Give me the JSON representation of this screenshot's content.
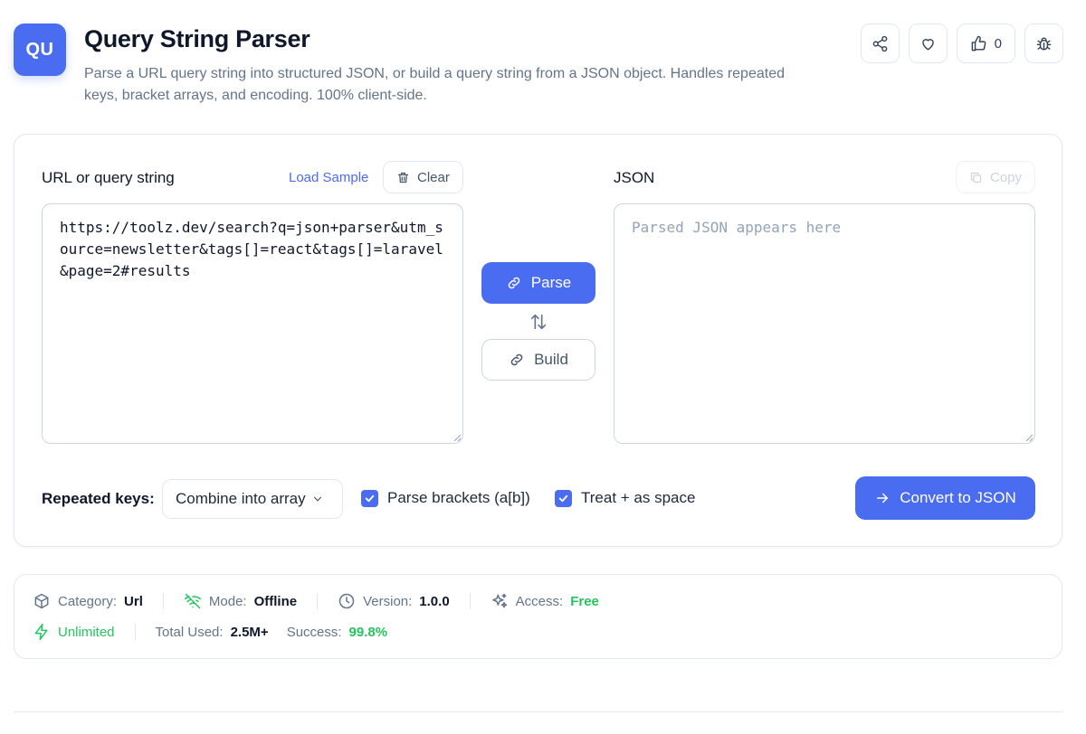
{
  "header": {
    "logo_text": "QU",
    "title": "Query String Parser",
    "description": "Parse a URL query string into structured JSON, or build a query string from a JSON object. Handles repeated keys, bracket arrays, and encoding. 100% client-side.",
    "like_count": "0"
  },
  "input": {
    "label": "URL or query string",
    "load_sample": "Load Sample",
    "clear": "Clear",
    "value": "https://toolz.dev/search?q=json+parser&utm_source=newsletter&tags[]=react&tags[]=laravel&page=2#results"
  },
  "output": {
    "label": "JSON",
    "copy": "Copy",
    "placeholder": "Parsed JSON appears here"
  },
  "actions": {
    "parse": "Parse",
    "build": "Build",
    "convert": "Convert to JSON"
  },
  "options": {
    "repeated_keys_label": "Repeated keys:",
    "repeated_keys_value": "Combine into array",
    "parse_brackets": "Parse brackets (a[b])",
    "treat_plus": "Treat + as space",
    "parse_brackets_checked": true,
    "treat_plus_checked": true
  },
  "meta": {
    "category_label": "Category:",
    "category_value": "Url",
    "mode_label": "Mode:",
    "mode_value": "Offline",
    "version_label": "Version:",
    "version_value": "1.0.0",
    "access_label": "Access:",
    "access_value": "Free",
    "unlimited": "Unlimited",
    "total_used_label": "Total Used:",
    "total_used_value": "2.5M+",
    "success_label": "Success:",
    "success_value": "99.8%"
  },
  "colors": {
    "accent": "#4a6cf0",
    "success": "#22c55e"
  }
}
